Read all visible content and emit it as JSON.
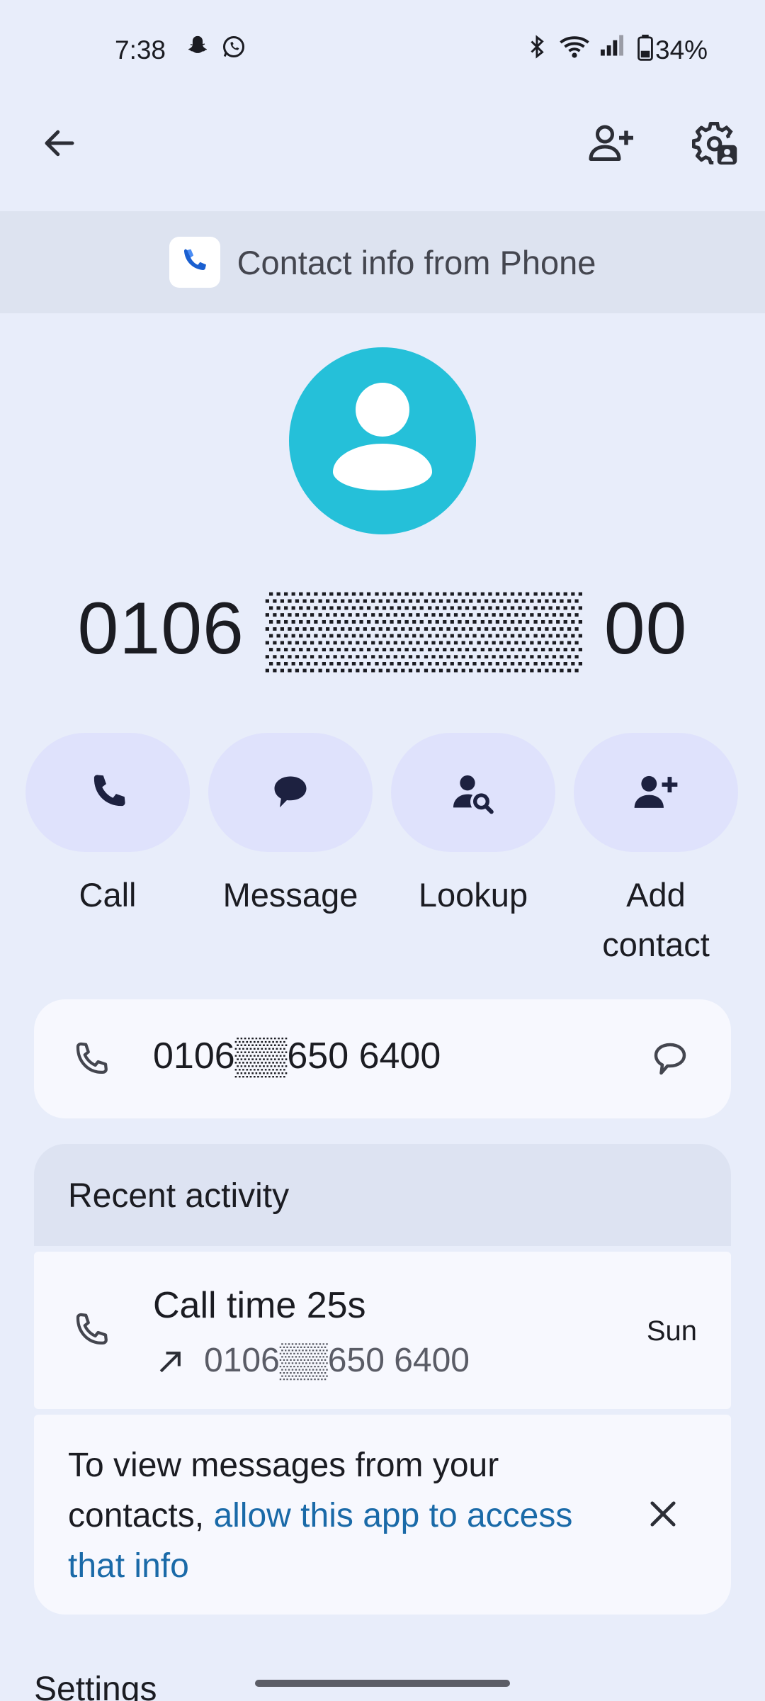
{
  "status_bar": {
    "time": "7:38",
    "battery": "34%",
    "icons": [
      "snapchat-icon",
      "whatsapp-icon",
      "bluetooth-icon",
      "wifi-icon",
      "signal-icon",
      "battery-icon"
    ]
  },
  "app_bar": {
    "icons": [
      "back-arrow-icon",
      "add-contact-icon",
      "contact-settings-icon"
    ]
  },
  "banner": {
    "text": "Contact info from Phone"
  },
  "contact": {
    "number_title": "0106 ▒▒▒▒▒▒ 00"
  },
  "actions": [
    {
      "label": "Call",
      "icon": "phone-icon"
    },
    {
      "label": "Message",
      "icon": "message-icon"
    },
    {
      "label": "Lookup",
      "icon": "person-search-icon"
    },
    {
      "label": "Add\ncontact",
      "icon": "person-add-icon"
    }
  ],
  "phone_entry": {
    "number": "0106▒▒650 6400"
  },
  "recent": {
    "header": "Recent activity",
    "items": [
      {
        "title": "Call time 25s",
        "number": "0106▒▒650 6400",
        "day": "Sun"
      }
    ]
  },
  "message_permission": {
    "text_before": "To view messages from your contacts, ",
    "link": "allow this app to access that info"
  },
  "settings": {
    "label": "Settings"
  },
  "colors": {
    "background": "#e8edfa",
    "avatar": "#25c0d9",
    "link": "#1a6aa8",
    "action_pill": "#dfe2fc"
  }
}
